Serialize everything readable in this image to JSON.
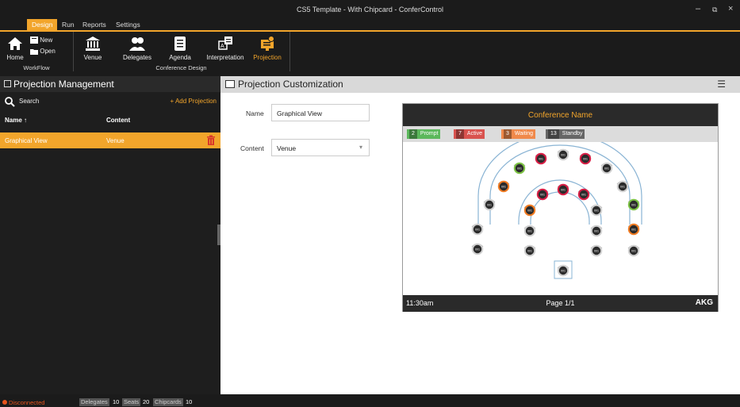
{
  "window": {
    "title": "CS5 Template - With Chipcard - ConferControl"
  },
  "menu_tabs": [
    "Design",
    "Run",
    "Reports",
    "Settings"
  ],
  "ribbon": {
    "home": "Home",
    "new": "New",
    "open": "Open",
    "venue": "Venue",
    "delegates": "Delegates",
    "agenda": "Agenda",
    "interpretation": "Interpretation",
    "projection": "Projection",
    "group_workflow": "WorkFlow",
    "group_conference_design": "Conference Design"
  },
  "left_panel": {
    "title": "Projection Management",
    "search_label": "Search",
    "add_button": "+ Add Projection",
    "col_name": "Name ↑",
    "col_content": "Content",
    "rows": [
      {
        "name": "Graphical View",
        "content": "Venue"
      }
    ]
  },
  "right_panel": {
    "title": "Projection Customization",
    "name_label": "Name",
    "name_value": "Graphical View",
    "content_label": "Content",
    "content_value": "Venue"
  },
  "preview": {
    "header": "Conference Name",
    "legend": [
      {
        "count": "2",
        "label": "Prompt",
        "color": "#5cb85c"
      },
      {
        "count": "7",
        "label": "Active",
        "color": "#d9534f"
      },
      {
        "count": "3",
        "label": "Waiting",
        "color": "#f0894b"
      },
      {
        "count": "13",
        "label": "Standby",
        "color": "#666666"
      }
    ],
    "seat_label": "001",
    "time": "11:30am",
    "page": "Page 1/1",
    "logo": "AKG"
  },
  "status": {
    "connection": "Disconnected",
    "delegates_label": "Delegates",
    "delegates_value": "10",
    "seats_label": "Seats",
    "seats_value": "20",
    "chipcards_label": "Chipcards",
    "chipcards_value": "10"
  },
  "colors": {
    "accent": "#f2a52b",
    "disconnected": "#e8541c"
  }
}
